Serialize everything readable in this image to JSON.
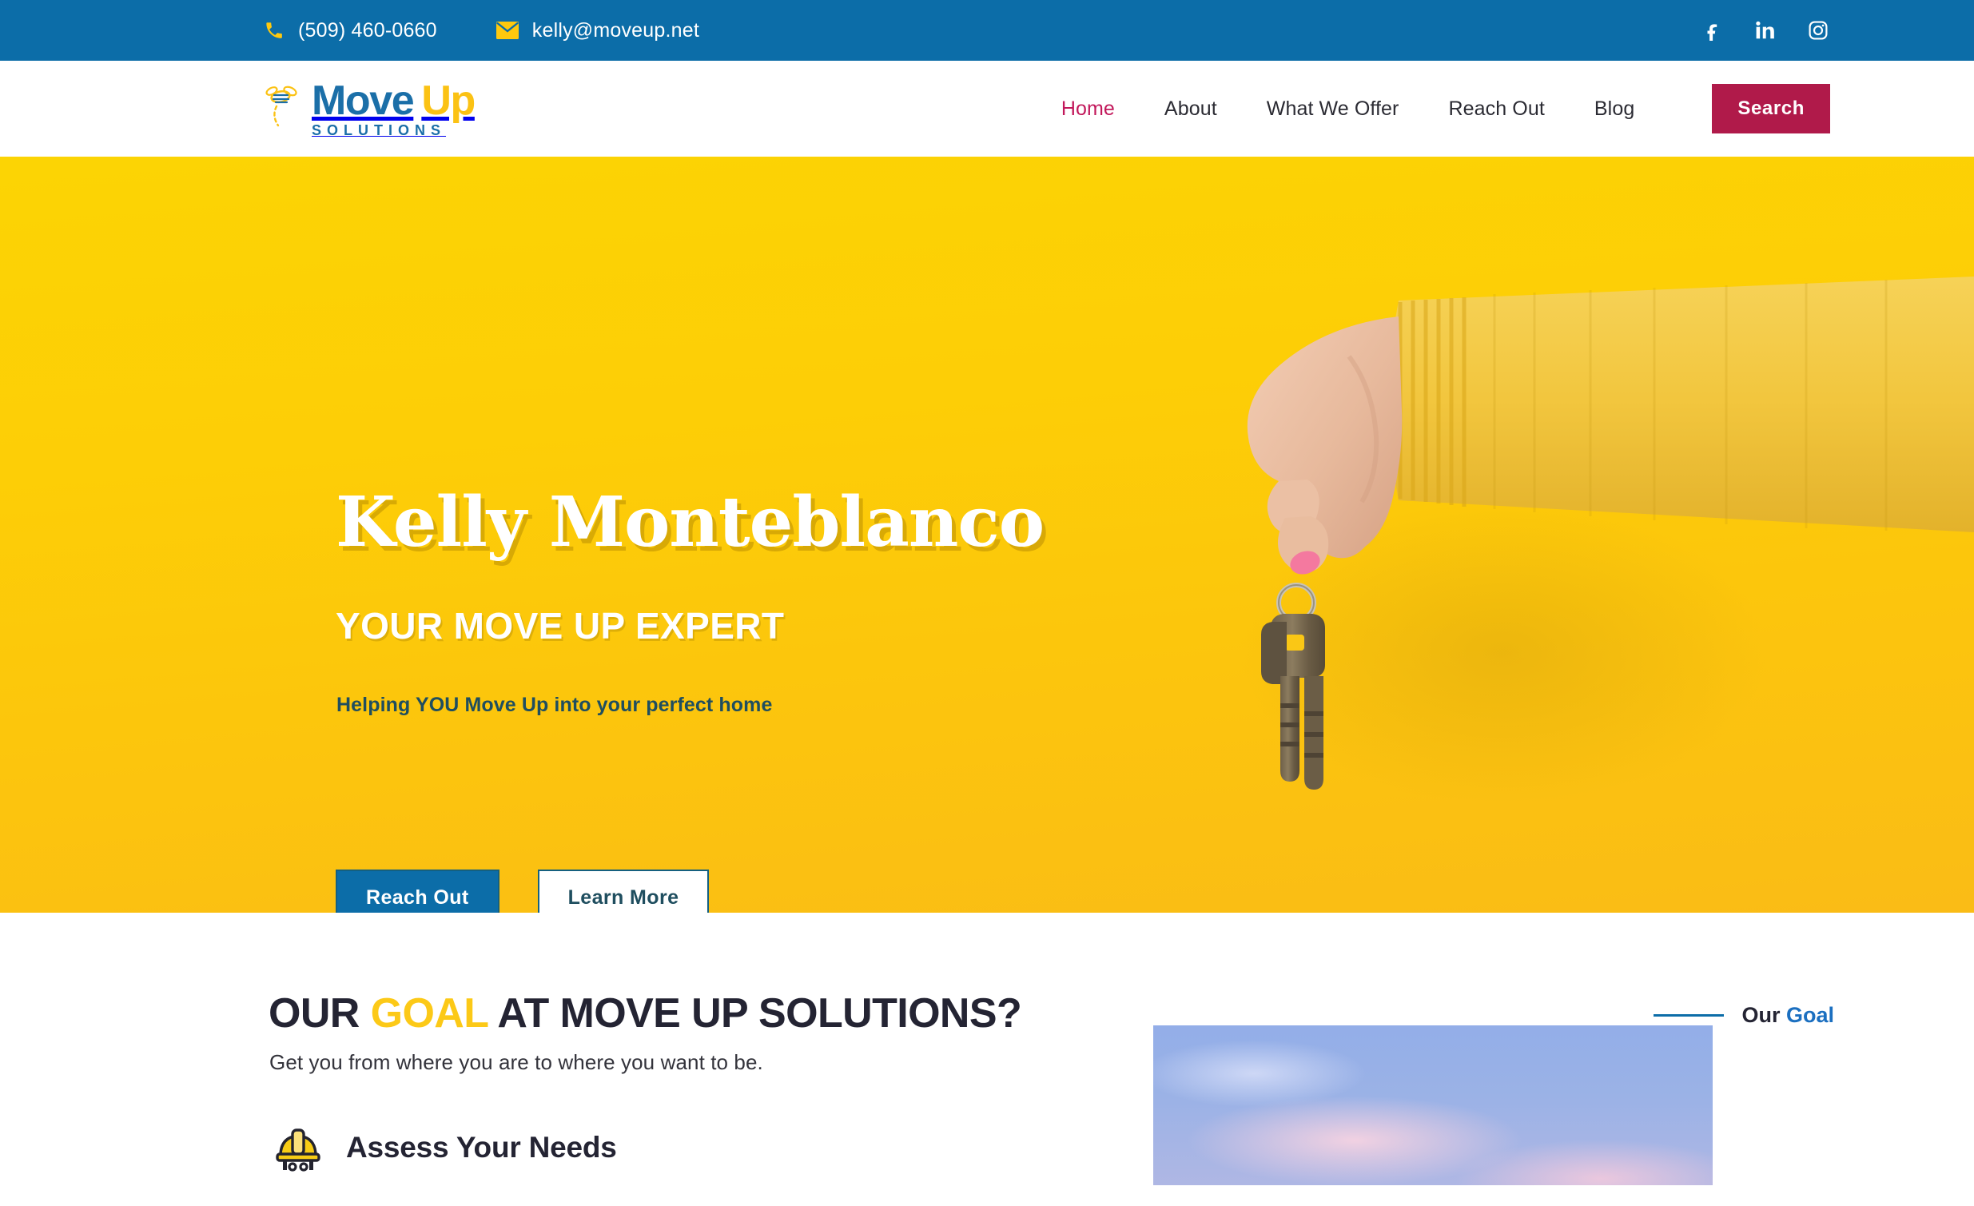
{
  "topbar": {
    "phone": "(509) 460-0660",
    "email": "kelly@moveup.net",
    "phone_icon": "phone-icon",
    "email_icon": "envelope-icon",
    "social": [
      {
        "name": "facebook",
        "label": "Facebook"
      },
      {
        "name": "linkedin",
        "label": "LinkedIn"
      },
      {
        "name": "instagram",
        "label": "Instagram"
      }
    ],
    "background_color": "#0C6DA8",
    "icon_color": "#FFC90E"
  },
  "header": {
    "logo": {
      "word1": "Move",
      "word2": "Up",
      "tagline": "SOLUTIONS",
      "icon": "bee-icon",
      "word1_color": "#1B6FA8",
      "word2_color": "#FBC214"
    },
    "nav": [
      {
        "label": "Home",
        "active": true
      },
      {
        "label": "About",
        "active": false
      },
      {
        "label": "What We Offer",
        "active": false
      },
      {
        "label": "Reach Out",
        "active": false
      },
      {
        "label": "Blog",
        "active": false
      }
    ],
    "search_label": "Search",
    "search_color": "#B01A4A"
  },
  "hero": {
    "title": "Kelly Monteblanco",
    "subtitle": "YOUR MOVE UP EXPERT",
    "tagline": "Helping YOU Move Up into your perfect home",
    "primary_button": "Reach Out",
    "secondary_button": "Learn More",
    "background_color": "#FCD404",
    "image_alt": "hand-holding-keys-photo"
  },
  "goal": {
    "heading_before": "OUR ",
    "heading_highlight": "GOAL",
    "heading_after": " AT MOVE UP SOLUTIONS?",
    "eyebrow_before": "Our ",
    "eyebrow_highlight": "Goal",
    "description": "Get you from where you are to where you want to be.",
    "feature_title": "Assess Your Needs",
    "feature_icon": "hard-hat-icon",
    "highlight_color": "#FCC917",
    "accent_color": "#0C6DA8",
    "side_image_alt": "sky-clouds-photo"
  }
}
